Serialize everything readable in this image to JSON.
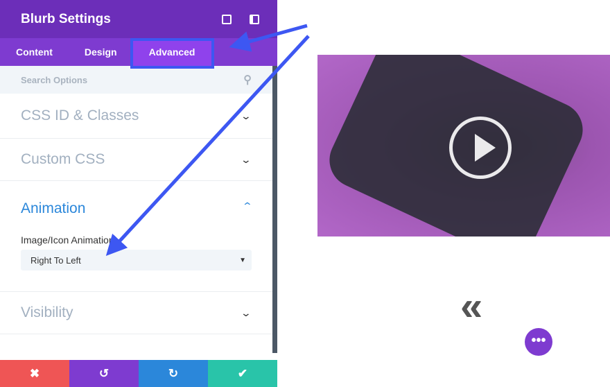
{
  "header": {
    "title": "Blurb Settings",
    "icons": [
      "fullscreen-icon",
      "sidebar-layout-icon"
    ]
  },
  "tabs": [
    {
      "label": "Content"
    },
    {
      "label": "Design"
    },
    {
      "label": "Advanced",
      "active": true
    }
  ],
  "search": {
    "placeholder": "Search Options"
  },
  "sections": {
    "css_id": "CSS ID & Classes",
    "custom_css": "Custom CSS",
    "animation": "Animation",
    "visibility": "Visibility"
  },
  "animation": {
    "field_label": "Image/Icon Animation",
    "selected": "Right To Left"
  },
  "footer": {
    "colors": [
      "#ef5555",
      "#7e3bd0",
      "#2b87da",
      "#29c4a9"
    ],
    "icons": [
      "close-icon",
      "undo-icon",
      "redo-icon",
      "check-icon"
    ],
    "glyphs": [
      "✖",
      "↺",
      "↻",
      "✔"
    ]
  },
  "media": {
    "fab": "•••",
    "double_chevron": "«"
  },
  "colors": {
    "header": "#6c2eb9",
    "tabs": "#7e3bd0",
    "accent": "#2b87da",
    "highlight": "#3d57f2"
  }
}
